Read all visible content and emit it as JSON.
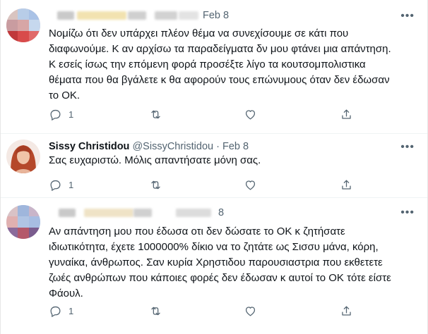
{
  "tweets": [
    {
      "name": "",
      "handle": "",
      "date": "Feb 8",
      "text_lines": [
        "Νομίζω ότι δεν υπάρχει πλέον θέμα να συνεχίσουμε σε κάτι που",
        "διαφωνούμε. Κ αν αρχίσω τα παραδείγματα δν μου φτάνει μια απάντηση.",
        "Κ εσείς ίσως την επόμενη φορά προσέξτε λίγο τα κουτσομπολιστικα",
        "θέματα που θα βγάλετε κ θα αφορούν τους επώνυμους όταν δεν έδωσαν",
        "το ΟΚ."
      ],
      "reply_count": "1",
      "retweet_count": "",
      "like_count": ""
    },
    {
      "name": "Sissy Christidou",
      "handle": "@SissyChristidou",
      "separator": "·",
      "date": "Feb 8",
      "text_lines": [
        "Σας ευχαριστώ. Μόλις απαντήσατε μόνη σας."
      ],
      "reply_count": "1",
      "retweet_count": "",
      "like_count": ""
    },
    {
      "name": "",
      "handle": "",
      "date": "8",
      "text_lines": [
        "Αν απάντηση μου που έδωσα οτι δεν δώσατε το ΟΚ κ ζητήσατε",
        "ιδιωτικότητα, έχετε 1000000% δίκιο να το ζητάτε ως Σισσυ μάνα, κόρη,",
        "γυναίκα, άνθρωπος. Σαν κυρία Χρηστιδου παρουσιαστρια που εκθετετε",
        "ζωές ανθρώπων που κάποιες φορές δεν έδωσαν κ αυτοί το ΟΚ τότε είστε",
        "Φάουλ."
      ],
      "reply_count": "1",
      "retweet_count": "",
      "like_count": ""
    }
  ],
  "icons": {
    "reply": "reply-icon",
    "retweet": "retweet-icon",
    "like": "like-icon",
    "share": "share-icon",
    "more": "more-icon"
  },
  "colors": {
    "text": "#0f1419",
    "muted": "#536471",
    "divider": "#eff3f4"
  }
}
